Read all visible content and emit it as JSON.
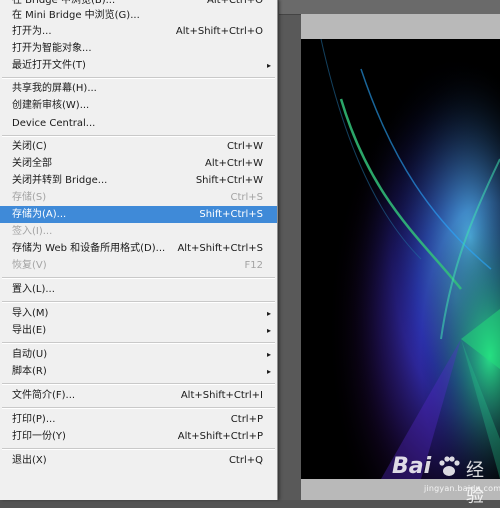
{
  "menu": {
    "items": [
      {
        "label": "在 Bridge 中浏览(B)...",
        "shortcut": "Alt+Ctrl+O"
      },
      {
        "label": "在 Mini Bridge 中浏览(G)...",
        "shortcut": ""
      },
      {
        "label": "打开为...",
        "shortcut": "Alt+Shift+Ctrl+O"
      },
      {
        "label": "打开为智能对象...",
        "shortcut": ""
      },
      {
        "label": "最近打开文件(T)",
        "shortcut": ""
      },
      {
        "label": "共享我的屏幕(H)...",
        "shortcut": ""
      },
      {
        "label": "创建新审核(W)...",
        "shortcut": ""
      },
      {
        "label": "Device Central...",
        "shortcut": ""
      },
      {
        "label": "关闭(C)",
        "shortcut": "Ctrl+W"
      },
      {
        "label": "关闭全部",
        "shortcut": "Alt+Ctrl+W"
      },
      {
        "label": "关闭并转到 Bridge...",
        "shortcut": "Shift+Ctrl+W"
      },
      {
        "label": "存储(S)",
        "shortcut": "Ctrl+S"
      },
      {
        "label": "存储为(A)...",
        "shortcut": "Shift+Ctrl+S"
      },
      {
        "label": "签入(I)...",
        "shortcut": ""
      },
      {
        "label": "存储为 Web 和设备所用格式(D)...",
        "shortcut": "Alt+Shift+Ctrl+S"
      },
      {
        "label": "恢复(V)",
        "shortcut": "F12"
      },
      {
        "label": "置入(L)...",
        "shortcut": ""
      },
      {
        "label": "导入(M)",
        "shortcut": ""
      },
      {
        "label": "导出(E)",
        "shortcut": ""
      },
      {
        "label": "自动(U)",
        "shortcut": ""
      },
      {
        "label": "脚本(R)",
        "shortcut": ""
      },
      {
        "label": "文件简介(F)...",
        "shortcut": "Alt+Shift+Ctrl+I"
      },
      {
        "label": "打印(P)...",
        "shortcut": "Ctrl+P"
      },
      {
        "label": "打印一份(Y)",
        "shortcut": "Alt+Shift+Ctrl+P"
      },
      {
        "label": "退出(X)",
        "shortcut": "Ctrl+Q"
      }
    ],
    "selected_label": "存储为(A)...",
    "submenu_glyph": "▸"
  },
  "watermark": {
    "logo_text": "Bai",
    "brand_text": "经验",
    "url": "jingyan.baidu.com"
  },
  "colors": {
    "highlight": "#3f8ad8",
    "menu_bg": "#f0f0f0",
    "disabled_text": "#a3a3a3"
  }
}
